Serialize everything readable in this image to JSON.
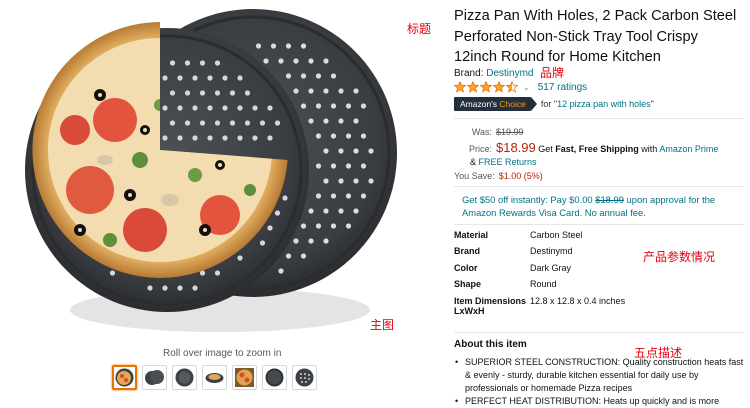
{
  "product": {
    "title": "Pizza Pan With Holes, 2 Pack Carbon Steel Perforated Non-Stick Tray Tool Crispy 12inch Round for Home Kitchen",
    "brand_prefix": "Brand: ",
    "brand_name": "Destinymd",
    "rating_value": 4.5,
    "ratings_count_text": "517 ratings",
    "choice_badge_prefix": "Amazon's ",
    "choice_badge_word": "Choice",
    "choice_for_prefix": "for \"",
    "choice_query": "12 pizza pan with holes",
    "choice_for_suffix": "\""
  },
  "pricing": {
    "was_label": "Was:",
    "was_value": "$19.99",
    "price_label": "Price:",
    "price_value": "$18.99",
    "shipping_text": " Get ",
    "shipping_bold": "Fast, Free Shipping",
    "shipping_with": " with ",
    "prime_link": "Amazon Prime",
    "returns_prefix": "& ",
    "returns_link": "FREE Returns",
    "save_label": "You Save:",
    "save_value": "$1.00 (5%)"
  },
  "offer": {
    "text_1": "Get $50 off instantly: Pay $0.00 ",
    "strike": "$18.99",
    "text_2": " upon approval for the Amazon Rewards Visa Card. No annual fee."
  },
  "specs": [
    {
      "key": "Material",
      "value": "Carbon Steel"
    },
    {
      "key": "Brand",
      "value": "Destinymd"
    },
    {
      "key": "Color",
      "value": "Dark Gray"
    },
    {
      "key": "Shape",
      "value": "Round"
    },
    {
      "key": "Item Dimensions LxWxH",
      "value": "12.8 x 12.8 x 0.4 inches"
    }
  ],
  "about": {
    "title": "About this item",
    "bullets": [
      "SUPERIOR STEEL CONSTRUCTION: Quality construction heats fast & evenly - sturdy, durable kitchen essential for daily use by professionals or homemade Pizza recipes",
      "PERFECT HEAT DISTRIBUTION: Heats up quickly and is more"
    ]
  },
  "gallery": {
    "zoom_hint": "Roll over image to zoom in",
    "thumbnails": [
      "pizza-on-pan",
      "two-pans",
      "pans-stacked",
      "pan-side",
      "pizza-slices",
      "pan-top",
      "pan-perforated"
    ]
  },
  "annotations": {
    "title": "标题",
    "brand": "品牌",
    "params": "产品参数情况",
    "main_image": "主图",
    "five_points": "五点描述"
  },
  "colors": {
    "link": "#007185",
    "price": "#b12704",
    "annotation": "#e3000f",
    "star": "#ffa41c",
    "badge": "#232f3e"
  }
}
